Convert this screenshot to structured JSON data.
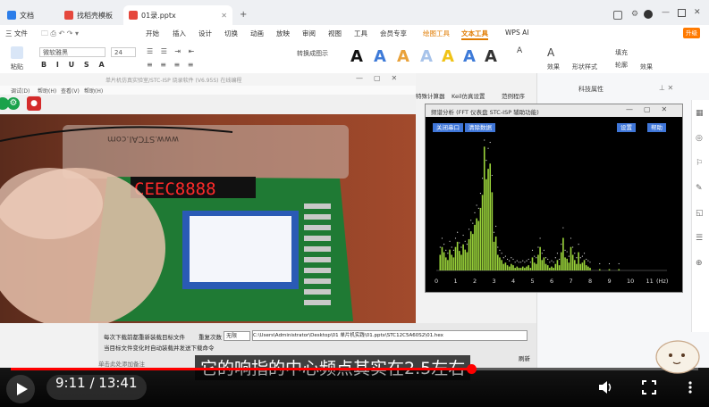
{
  "wps": {
    "tabs": [
      {
        "label": "文档",
        "color": "#2b7de9"
      },
      {
        "label": "找稻壳模板",
        "color": "#e5473c"
      },
      {
        "label": "01录.pptx",
        "color": "#e5473c"
      }
    ],
    "upgrade_label": "升级",
    "menu": [
      {
        "label": "三 文件"
      },
      {
        "label": "开始"
      },
      {
        "label": "插入"
      },
      {
        "label": "设计"
      },
      {
        "label": "切换"
      },
      {
        "label": "动画"
      },
      {
        "label": "放映"
      },
      {
        "label": "审阅"
      },
      {
        "label": "视图"
      },
      {
        "label": "工具"
      },
      {
        "label": "会员专享"
      },
      {
        "label": "绘图工具"
      },
      {
        "label": "文本工具"
      },
      {
        "label": "WPS AI"
      }
    ],
    "ribbon": {
      "paste_label": "粘贴",
      "font_name": "微软雅黑",
      "font_size": "24",
      "convert_label": "转换成图示",
      "fill_label": "填充",
      "outline_label": "轮廓",
      "effect_label": "效果",
      "shape_style_label": "形状样式",
      "effect2_label": "效果"
    },
    "right_pane": {
      "title": "科技属性"
    }
  },
  "software": {
    "title": "单片机仿真实验室/STC-ISP 烧录软件 (V6.95S) 在线编程",
    "menu": [
      "调试(D)",
      "帮助(H)",
      "查看(V)",
      "帮助(H)"
    ],
    "right_tabs": [
      "特殊计算器",
      "Keil仿真设置",
      "范例程序"
    ],
    "path_text": "C:\\Users\\Administrator\\Desktop\\01 单片机实践\\01.pptx\\STC12C5A60S2\\01.hex",
    "checkbox1": "每次下载前都重新装载目标文件",
    "checkbox2": "当目标文件变化时自动装载并发送下载命令",
    "reload_label": "重复次数",
    "reload_value": "无限",
    "refresh_label": "刷新",
    "status": "单击此处添加备注"
  },
  "fft": {
    "title": "频谱分析 (FFT 仪表盘 STC-ISP 辅助功能)",
    "btn_open": "关闭串口",
    "btn_clear": "清除数据",
    "btn_settings": "设置",
    "btn_help": "帮助",
    "x_ticks": [
      "0",
      "1",
      "2",
      "3",
      "4",
      "5",
      "6",
      "7",
      "8",
      "9",
      "10",
      "11"
    ],
    "unit": "(Hz)"
  },
  "led_display": "CEEC8888",
  "board_text": "www.STCAI.com",
  "player": {
    "time": "9:11 / 13:41",
    "progress": 0.67,
    "subtitle": "它的响指的中心频点其实在2.5左右"
  },
  "chart_data": {
    "type": "bar",
    "title": "",
    "xlabel": "(Hz)",
    "ylabel": "",
    "xlim": [
      0,
      12
    ],
    "x": [
      0.2,
      0.3,
      0.4,
      0.5,
      0.6,
      0.7,
      0.8,
      0.9,
      1.0,
      1.1,
      1.2,
      1.3,
      1.4,
      1.5,
      1.6,
      1.7,
      1.8,
      1.9,
      2.0,
      2.1,
      2.2,
      2.3,
      2.4,
      2.5,
      2.6,
      2.7,
      2.8,
      2.9,
      3.0,
      3.1,
      3.2,
      3.3,
      3.4,
      3.5,
      3.6,
      3.7,
      3.8,
      3.9,
      4.0,
      4.1,
      4.2,
      4.3,
      4.4,
      4.5,
      4.6,
      4.7,
      4.8,
      4.9,
      5.0,
      5.1,
      5.2,
      5.3,
      5.4,
      5.5,
      5.6,
      5.7,
      5.8,
      5.9,
      6.0,
      6.1,
      6.2,
      6.3,
      6.4,
      6.5,
      6.6,
      6.7,
      6.8,
      6.9,
      7.0,
      7.1,
      7.2,
      7.3,
      7.4,
      7.5,
      7.6,
      7.7,
      7.8,
      7.9,
      8.0,
      8.5,
      9.0,
      9.5
    ],
    "values": [
      0.12,
      0.18,
      0.14,
      0.1,
      0.08,
      0.16,
      0.12,
      0.1,
      0.18,
      0.22,
      0.15,
      0.12,
      0.2,
      0.16,
      0.14,
      0.24,
      0.3,
      0.28,
      0.35,
      0.4,
      0.38,
      0.48,
      0.58,
      0.95,
      0.7,
      0.78,
      0.82,
      0.6,
      0.22,
      0.26,
      0.12,
      0.1,
      0.08,
      0.05,
      0.06,
      0.04,
      0.03,
      0.05,
      0.04,
      0.02,
      0.03,
      0.02,
      0.02,
      0.03,
      0.02,
      0.03,
      0.04,
      0.02,
      0.1,
      0.06,
      0.05,
      0.12,
      0.18,
      0.08,
      0.1,
      0.05,
      0.04,
      0.02,
      0.03,
      0.02,
      0.05,
      0.08,
      0.04,
      0.14,
      0.25,
      0.1,
      0.09,
      0.06,
      0.18,
      0.12,
      0.08,
      0.05,
      0.14,
      0.05,
      0.06,
      0.08,
      0.04,
      0.03,
      0.02,
      0.01,
      0.01,
      0.01
    ],
    "color": "#9ad43a"
  }
}
